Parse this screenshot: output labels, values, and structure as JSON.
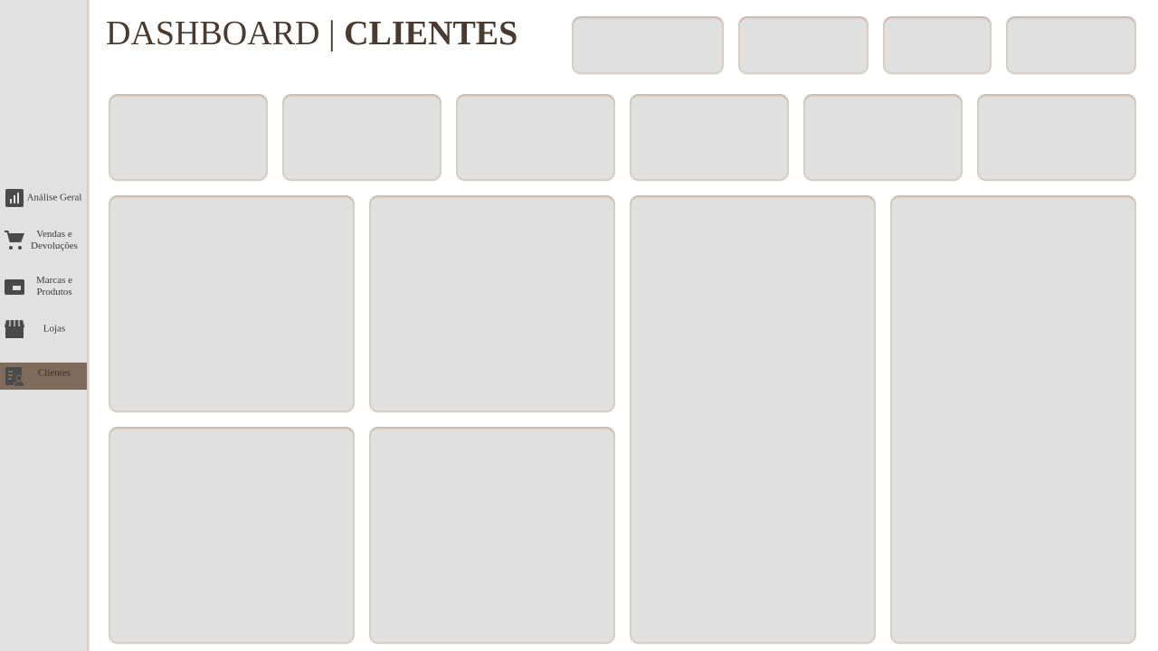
{
  "header": {
    "title_prefix": "DASHBOARD |",
    "title_main": "CLIENTES"
  },
  "sidebar": {
    "items": [
      {
        "label": "Análise Geral",
        "icon": "bar-chart-icon",
        "active": false
      },
      {
        "label": "Vendas e Devoluções",
        "icon": "cart-icon",
        "active": false
      },
      {
        "label": "Marcas e Produtos",
        "icon": "wallet-icon",
        "active": false
      },
      {
        "label": "Lojas",
        "icon": "store-icon",
        "active": false
      },
      {
        "label": "Clientes",
        "icon": "client-icon",
        "active": true
      }
    ]
  },
  "colors": {
    "accent": "#7f6b5c",
    "title": "#4a3b31",
    "card": "#e0e0e0",
    "sidebar": "#e1e1e1"
  }
}
